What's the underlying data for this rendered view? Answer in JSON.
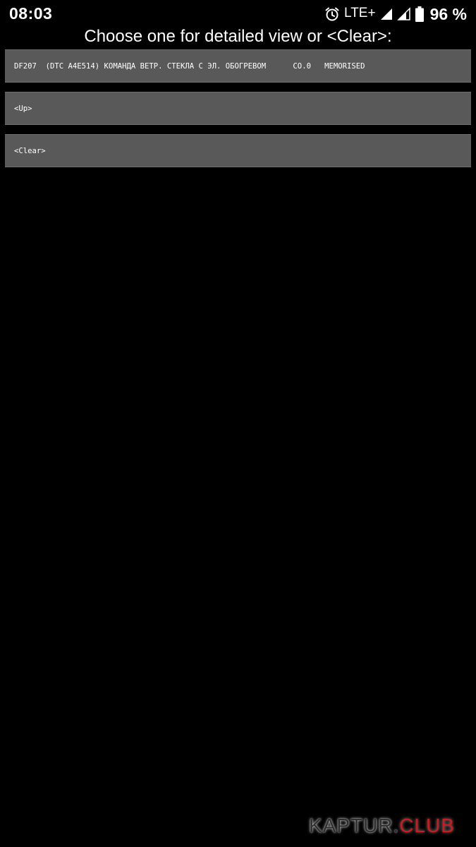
{
  "status_bar": {
    "time": "08:03",
    "network_label": "LTE+",
    "battery_percent": "96 %",
    "icons": [
      "alarm-icon",
      "signal-icon",
      "signal-icon",
      "battery-icon"
    ]
  },
  "prompt": {
    "title": "Choose one for detailed view or <Clear>:"
  },
  "list": {
    "items": [
      {
        "label": "DF207  (DTC A4E514) КОМАНДА ВЕТР. СТЕКЛА С ЭЛ. ОБОГРЕВОМ      CO.0   MEMORISED"
      },
      {
        "label": "<Up>"
      },
      {
        "label": "<Clear>"
      }
    ]
  },
  "watermark": {
    "part1": "KAPTUR.",
    "part2": "CLUB"
  },
  "colors": {
    "background": "#000000",
    "list_item_bg": "#595959",
    "watermark_accent": "#d0191e"
  }
}
